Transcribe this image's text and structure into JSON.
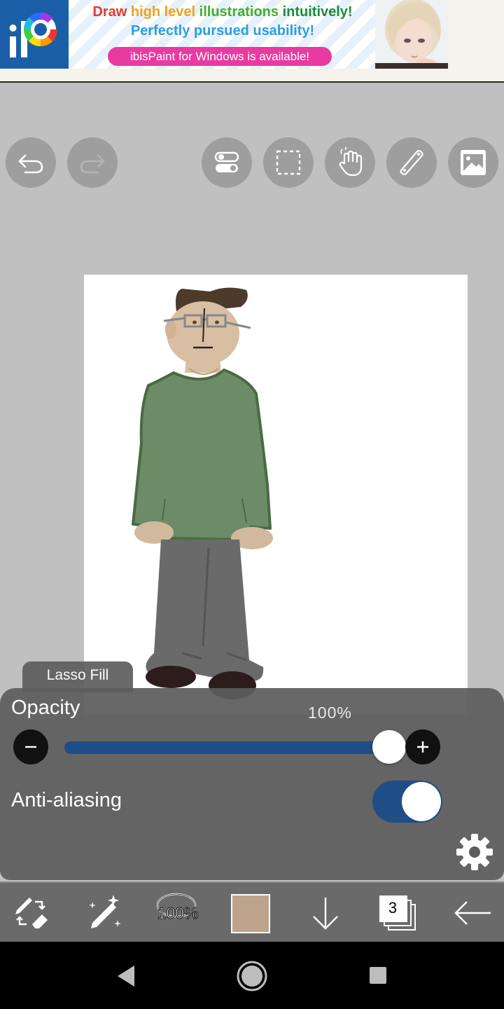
{
  "ad": {
    "line1_words": [
      {
        "text": "Draw ",
        "color": "#e23b2e"
      },
      {
        "text": "high level ",
        "color": "#f0a21b"
      },
      {
        "text": "illustrations ",
        "color": "#3fae2a"
      },
      {
        "text": "intuitively!",
        "color": "#1f8a3a"
      }
    ],
    "line2": "Perfectly pursued usability!",
    "pill": "ibisPaint for Windows is available!",
    "logo_icon": "ibispaint-logo-icon"
  },
  "top_tools": [
    {
      "name": "undo-button",
      "icon": "undo-icon",
      "enabled": true
    },
    {
      "name": "redo-button",
      "icon": "redo-icon",
      "enabled": false
    },
    {
      "name": "toggle-panel-button",
      "icon": "toggles-icon",
      "enabled": true
    },
    {
      "name": "selection-button",
      "icon": "selection-icon",
      "enabled": true
    },
    {
      "name": "hand-tool-button",
      "icon": "hand-icon",
      "enabled": true
    },
    {
      "name": "ruler-button",
      "icon": "ruler-icon",
      "enabled": true
    },
    {
      "name": "reference-image-button",
      "icon": "image-icon",
      "enabled": true
    }
  ],
  "panel": {
    "tab_label": "Lasso Fill",
    "opacity_label": "Opacity",
    "opacity_value": "100%",
    "opacity_fraction": 1.0,
    "anti_aliasing_label": "Anti-aliasing",
    "anti_aliasing_on": true
  },
  "toolbar": {
    "brush_size": "100%",
    "current_color": "#bda38b",
    "layer_count": "3",
    "icons": [
      "tool-swap-icon",
      "magic-pen-icon",
      "brush-size-icon",
      "color-swatch",
      "download-arrow-icon",
      "layers-icon",
      "back-arrow-icon"
    ]
  },
  "colors": {
    "accent": "#1f4d86",
    "panel": "#5c5c5c",
    "workspace": "#c0c0c0"
  }
}
